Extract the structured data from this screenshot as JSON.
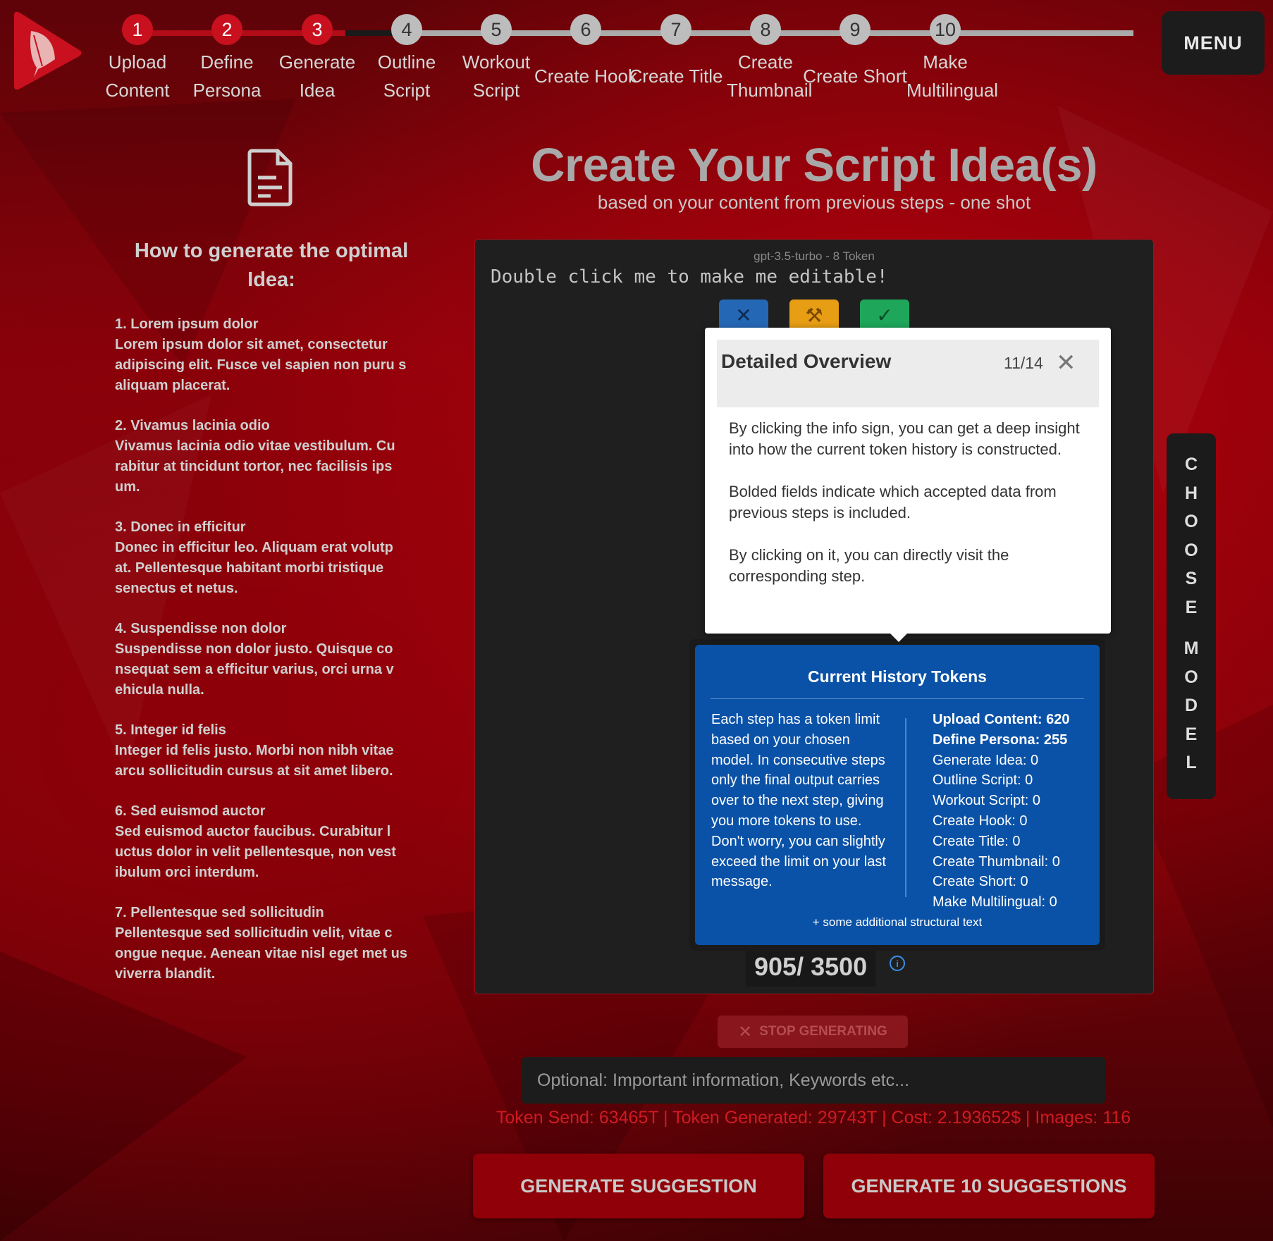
{
  "steps": [
    {
      "num": "1",
      "label": "Upload Content",
      "done": true
    },
    {
      "num": "2",
      "label": "Define Persona",
      "done": true
    },
    {
      "num": "3",
      "label": "Generate Idea",
      "done": true
    },
    {
      "num": "4",
      "label": "Outline Script",
      "done": false
    },
    {
      "num": "5",
      "label": "Workout Script",
      "done": false
    },
    {
      "num": "6",
      "label": "Create Hook",
      "done": false
    },
    {
      "num": "7",
      "label": "Create Title",
      "done": false
    },
    {
      "num": "8",
      "label": "Create Thumbnail",
      "done": false
    },
    {
      "num": "9",
      "label": "Create Short",
      "done": false
    },
    {
      "num": "10",
      "label": "Make Multilingual",
      "done": false
    }
  ],
  "menu_label": "MENU",
  "left_panel": {
    "title": "How to generate the optimal Idea:",
    "items": [
      {
        "title": "1. Lorem ipsum dolor",
        "text": "Lorem ipsum dolor sit amet, consectetur adipiscing elit. Fusce vel sapien non puru s aliquam placerat."
      },
      {
        "title": "2. Vivamus lacinia odio",
        "text": "Vivamus lacinia odio vitae vestibulum. Cu rabitur at tincidunt tortor, nec facilisis ips um."
      },
      {
        "title": "3. Donec in efficitur",
        "text": "Donec in efficitur leo. Aliquam erat volutp at. Pellentesque habitant morbi tristique senectus et netus."
      },
      {
        "title": "4. Suspendisse non dolor",
        "text": "Suspendisse non dolor justo. Quisque co nsequat sem a efficitur varius, orci urna v ehicula nulla."
      },
      {
        "title": "5. Integer id felis",
        "text": "Integer id felis justo. Morbi non nibh vitae arcu sollicitudin cursus at sit amet libero."
      },
      {
        "title": "6. Sed euismod auctor",
        "text": "Sed euismod auctor faucibus. Curabitur l uctus dolor in velit pellentesque, non vest ibulum orci interdum."
      },
      {
        "title": "7. Pellentesque sed sollicitudin",
        "text": "Pellentesque sed sollicitudin velit, vitae c ongue neque. Aenean vitae nisl eget met us viverra blandit."
      }
    ]
  },
  "header": {
    "title": "Create Your Script Idea(s)",
    "subtitle": "based on your content from previous steps - one shot"
  },
  "editor": {
    "model_line": "gpt-3.5-turbo - 8 Token",
    "placeholder_text": "Double click me to make me editable!",
    "counter": "905/ 3500"
  },
  "popover": {
    "title": "Detailed Overview",
    "count": "11/14",
    "paragraphs": [
      "By clicking the info sign, you can get a deep insight into how the current token history is constructed.",
      "Bolded fields indicate which accepted data from previous steps is included.",
      "By clicking on it, you can directly visit the corresponding step."
    ]
  },
  "history_tokens": {
    "title": "Current History Tokens",
    "description": "Each step has a token limit based on your chosen model. In consecutive steps only the final output carries over to the next step, giving you more tokens to use. Don't worry, you can slightly exceed the limit on your last message.",
    "entries": [
      {
        "text": "Upload Content: 620",
        "bold": true
      },
      {
        "text": "Define Persona: 255",
        "bold": true
      },
      {
        "text": "Generate Idea: 0",
        "bold": false
      },
      {
        "text": "Outline Script: 0",
        "bold": false
      },
      {
        "text": "Workout Script: 0",
        "bold": false
      },
      {
        "text": "Create Hook: 0",
        "bold": false
      },
      {
        "text": "Create Title: 0",
        "bold": false
      },
      {
        "text": "Create Thumbnail: 0",
        "bold": false
      },
      {
        "text": "Create Short: 0",
        "bold": false
      },
      {
        "text": "Make Multilingual: 0",
        "bold": false
      }
    ],
    "footer": "+ some additional structural text"
  },
  "choose_model_letters": [
    "C",
    "H",
    "O",
    "O",
    "S",
    "E",
    "",
    "M",
    "O",
    "D",
    "E",
    "L"
  ],
  "stop_label": "STOP GENERATING",
  "optional_input": {
    "placeholder": "Optional: Important information, Keywords etc...",
    "value": ""
  },
  "stats": "Token Send: 63465T  | Token  Generated: 29743T  |  Cost: 2.193652$  | Images: 116",
  "buttons": {
    "generate_one": "GENERATE SUGGESTION",
    "generate_ten": "GENERATE 10 SUGGESTIONS"
  },
  "colors": {
    "accent": "#c8101e",
    "token_panel": "#0a52a8"
  }
}
